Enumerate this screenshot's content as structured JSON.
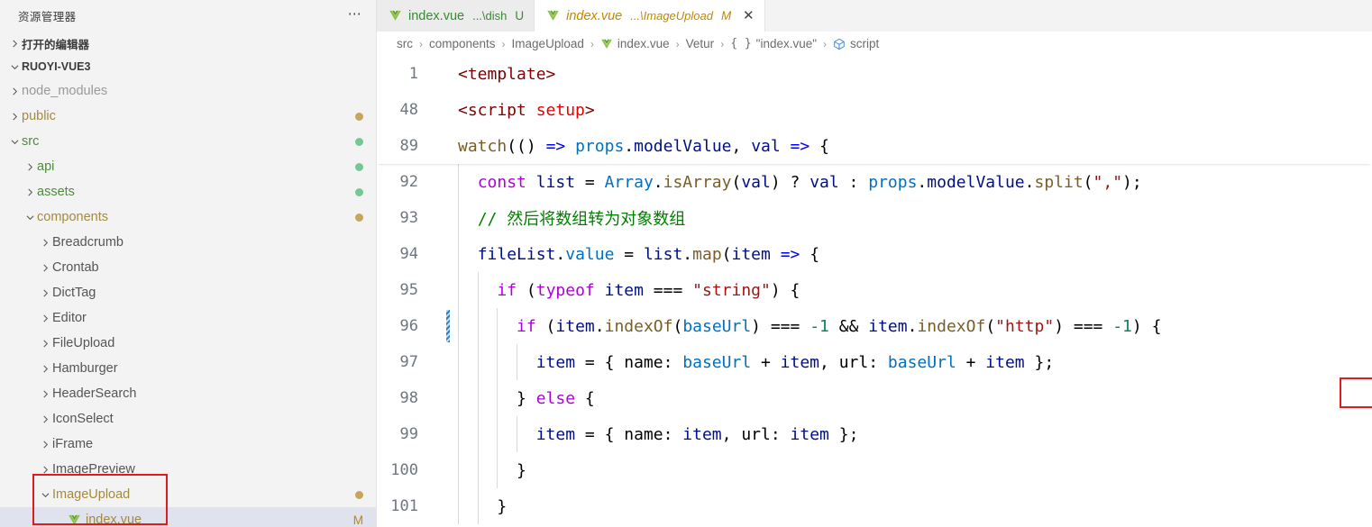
{
  "sidebar": {
    "title": "资源管理器",
    "more_label": "⋯",
    "open_editors_label": "打开的编辑器",
    "project_label": "RUOYI-VUE3",
    "tree": [
      {
        "label": "node_modules",
        "indent": 1,
        "arrow": "right",
        "color": "#9a9a9a",
        "status": ""
      },
      {
        "label": "public",
        "indent": 1,
        "arrow": "right",
        "color": "#a38a42",
        "status": "dot-mod"
      },
      {
        "label": "src",
        "indent": 1,
        "arrow": "down",
        "color": "#4f8a3f",
        "status": "dot-new"
      },
      {
        "label": "api",
        "indent": 2,
        "arrow": "right",
        "color": "#4f8a3f",
        "status": "dot-new"
      },
      {
        "label": "assets",
        "indent": 2,
        "arrow": "right",
        "color": "#4f8a3f",
        "status": "dot-new"
      },
      {
        "label": "components",
        "indent": 2,
        "arrow": "down",
        "color": "#a38a42",
        "status": "dot-mod"
      },
      {
        "label": "Breadcrumb",
        "indent": 3,
        "arrow": "right",
        "color": "#555555",
        "status": ""
      },
      {
        "label": "Crontab",
        "indent": 3,
        "arrow": "right",
        "color": "#555555",
        "status": ""
      },
      {
        "label": "DictTag",
        "indent": 3,
        "arrow": "right",
        "color": "#555555",
        "status": ""
      },
      {
        "label": "Editor",
        "indent": 3,
        "arrow": "right",
        "color": "#555555",
        "status": ""
      },
      {
        "label": "FileUpload",
        "indent": 3,
        "arrow": "right",
        "color": "#555555",
        "status": ""
      },
      {
        "label": "Hamburger",
        "indent": 3,
        "arrow": "right",
        "color": "#555555",
        "status": ""
      },
      {
        "label": "HeaderSearch",
        "indent": 3,
        "arrow": "right",
        "color": "#555555",
        "status": ""
      },
      {
        "label": "IconSelect",
        "indent": 3,
        "arrow": "right",
        "color": "#555555",
        "status": ""
      },
      {
        "label": "iFrame",
        "indent": 3,
        "arrow": "right",
        "color": "#555555",
        "status": ""
      },
      {
        "label": "ImagePreview",
        "indent": 3,
        "arrow": "right",
        "color": "#555555",
        "status": ""
      },
      {
        "label": "ImageUpload",
        "indent": 3,
        "arrow": "down",
        "color": "#a38a42",
        "status": "dot-mod"
      },
      {
        "label": "index.vue",
        "indent": 4,
        "arrow": "none",
        "color": "#a38a42",
        "status": "M",
        "icon": "vue",
        "selected": true
      }
    ],
    "colors": {
      "dot_modified": "#c8a45c",
      "dot_new": "#73c991",
      "badge_modified": "#bf8803",
      "annotation": "#e01b1b"
    }
  },
  "tabs": [
    {
      "name": "index.vue",
      "desc": "...\\dish",
      "badge": "U",
      "active": false,
      "color": "#388a34",
      "close": ""
    },
    {
      "name": "index.vue",
      "desc": "...\\ImageUpload",
      "badge": "M",
      "active": true,
      "color": "#bf8803",
      "close": "✕"
    }
  ],
  "breadcrumb": [
    {
      "label": "src",
      "icon": ""
    },
    {
      "label": "components",
      "icon": ""
    },
    {
      "label": "ImageUpload",
      "icon": ""
    },
    {
      "label": "index.vue",
      "icon": "vue-icon"
    },
    {
      "label": "Vetur",
      "icon": ""
    },
    {
      "label": "\"index.vue\"",
      "icon": "braces-icon"
    },
    {
      "label": "script",
      "icon": "cube-icon"
    }
  ],
  "breadcrumb_separator": "›",
  "sticky_lines": [
    {
      "num": "1",
      "tokens": [
        {
          "t": "<template>",
          "c": "t-tag"
        }
      ]
    },
    {
      "num": "48",
      "tokens": [
        {
          "t": "<script ",
          "c": "t-tag"
        },
        {
          "t": "setup",
          "c": "t-tagn"
        },
        {
          "t": ">",
          "c": "t-tag"
        }
      ]
    },
    {
      "num": "89",
      "tokens": [
        {
          "t": "watch",
          "c": "t-fn"
        },
        {
          "t": "((",
          "c": "t-punct"
        },
        {
          "t": ") ",
          "c": "t-punct"
        },
        {
          "t": "=>",
          "c": "t-arrow"
        },
        {
          "t": " ",
          "c": "t-plain"
        },
        {
          "t": "props",
          "c": "t-prop"
        },
        {
          "t": ".",
          "c": "t-punct"
        },
        {
          "t": "modelValue",
          "c": "t-var"
        },
        {
          "t": ", ",
          "c": "t-punct"
        },
        {
          "t": "val ",
          "c": "t-var"
        },
        {
          "t": "=>",
          "c": "t-arrow"
        },
        {
          "t": " {",
          "c": "t-punct"
        }
      ]
    }
  ],
  "code_lines": [
    {
      "num": "92",
      "indent": 2,
      "modified": false,
      "tokens": [
        {
          "t": "const",
          "c": "t-kw"
        },
        {
          "t": " ",
          "c": "t-plain"
        },
        {
          "t": "list",
          "c": "t-var"
        },
        {
          "t": " = ",
          "c": "t-punct"
        },
        {
          "t": "Array",
          "c": "t-prop"
        },
        {
          "t": ".",
          "c": "t-punct"
        },
        {
          "t": "isArray",
          "c": "t-fn"
        },
        {
          "t": "(",
          "c": "t-punct"
        },
        {
          "t": "val",
          "c": "t-var"
        },
        {
          "t": ") ? ",
          "c": "t-punct"
        },
        {
          "t": "val",
          "c": "t-var"
        },
        {
          "t": " : ",
          "c": "t-punct"
        },
        {
          "t": "props",
          "c": "t-prop"
        },
        {
          "t": ".",
          "c": "t-punct"
        },
        {
          "t": "modelValue",
          "c": "t-var"
        },
        {
          "t": ".",
          "c": "t-punct"
        },
        {
          "t": "split",
          "c": "t-fn"
        },
        {
          "t": "(",
          "c": "t-punct"
        },
        {
          "t": "\",\"",
          "c": "t-str"
        },
        {
          "t": ");",
          "c": "t-punct"
        }
      ]
    },
    {
      "num": "93",
      "indent": 2,
      "modified": false,
      "tokens": [
        {
          "t": "// 然后将数组转为对象数组",
          "c": "t-cmt"
        }
      ]
    },
    {
      "num": "94",
      "indent": 2,
      "modified": false,
      "tokens": [
        {
          "t": "fileList",
          "c": "t-var"
        },
        {
          "t": ".",
          "c": "t-punct"
        },
        {
          "t": "value",
          "c": "t-prop"
        },
        {
          "t": " = ",
          "c": "t-punct"
        },
        {
          "t": "list",
          "c": "t-var"
        },
        {
          "t": ".",
          "c": "t-punct"
        },
        {
          "t": "map",
          "c": "t-fn"
        },
        {
          "t": "(",
          "c": "t-punct"
        },
        {
          "t": "item ",
          "c": "t-var"
        },
        {
          "t": "=>",
          "c": "t-arrow"
        },
        {
          "t": " {",
          "c": "t-punct"
        }
      ]
    },
    {
      "num": "95",
      "indent": 3,
      "modified": false,
      "tokens": [
        {
          "t": "if",
          "c": "t-kw"
        },
        {
          "t": " (",
          "c": "t-punct"
        },
        {
          "t": "typeof",
          "c": "t-kw"
        },
        {
          "t": " ",
          "c": "t-plain"
        },
        {
          "t": "item",
          "c": "t-var"
        },
        {
          "t": " === ",
          "c": "t-punct"
        },
        {
          "t": "\"string\"",
          "c": "t-str"
        },
        {
          "t": ") {",
          "c": "t-punct"
        }
      ]
    },
    {
      "num": "96",
      "indent": 4,
      "modified": true,
      "tokens": [
        {
          "t": "if",
          "c": "t-kw"
        },
        {
          "t": " (",
          "c": "t-punct"
        },
        {
          "t": "item",
          "c": "t-var"
        },
        {
          "t": ".",
          "c": "t-punct"
        },
        {
          "t": "indexOf",
          "c": "t-fn"
        },
        {
          "t": "(",
          "c": "t-punct"
        },
        {
          "t": "baseUrl",
          "c": "t-prop"
        },
        {
          "t": ") === ",
          "c": "t-punct"
        },
        {
          "t": "-1",
          "c": "t-num"
        },
        {
          "t": " && ",
          "c": "t-punct"
        },
        {
          "t": "item",
          "c": "t-var"
        },
        {
          "t": ".",
          "c": "t-punct"
        },
        {
          "t": "indexOf",
          "c": "t-fn"
        },
        {
          "t": "(",
          "c": "t-punct"
        },
        {
          "t": "\"http\"",
          "c": "t-str"
        },
        {
          "t": ") === ",
          "c": "t-punct"
        },
        {
          "t": "-1",
          "c": "t-num"
        },
        {
          "t": ") {",
          "c": "t-punct"
        }
      ]
    },
    {
      "num": "97",
      "indent": 5,
      "modified": false,
      "tokens": [
        {
          "t": "item",
          "c": "t-var"
        },
        {
          "t": " = { ",
          "c": "t-punct"
        },
        {
          "t": "name",
          "c": "t-plain"
        },
        {
          "t": ": ",
          "c": "t-punct"
        },
        {
          "t": "baseUrl",
          "c": "t-prop"
        },
        {
          "t": " + ",
          "c": "t-punct"
        },
        {
          "t": "item",
          "c": "t-var"
        },
        {
          "t": ", ",
          "c": "t-punct"
        },
        {
          "t": "url",
          "c": "t-plain"
        },
        {
          "t": ": ",
          "c": "t-punct"
        },
        {
          "t": "baseUrl",
          "c": "t-prop"
        },
        {
          "t": " + ",
          "c": "t-punct"
        },
        {
          "t": "item",
          "c": "t-var"
        },
        {
          "t": " };",
          "c": "t-punct"
        }
      ]
    },
    {
      "num": "98",
      "indent": 4,
      "modified": false,
      "tokens": [
        {
          "t": "} ",
          "c": "t-punct"
        },
        {
          "t": "else",
          "c": "t-kw"
        },
        {
          "t": " {",
          "c": "t-punct"
        }
      ]
    },
    {
      "num": "99",
      "indent": 5,
      "modified": false,
      "tokens": [
        {
          "t": "item",
          "c": "t-var"
        },
        {
          "t": " = { ",
          "c": "t-punct"
        },
        {
          "t": "name",
          "c": "t-plain"
        },
        {
          "t": ": ",
          "c": "t-punct"
        },
        {
          "t": "item",
          "c": "t-var"
        },
        {
          "t": ", ",
          "c": "t-punct"
        },
        {
          "t": "url",
          "c": "t-plain"
        },
        {
          "t": ": ",
          "c": "t-punct"
        },
        {
          "t": "item",
          "c": "t-var"
        },
        {
          "t": " };",
          "c": "t-punct"
        }
      ]
    },
    {
      "num": "100",
      "indent": 4,
      "modified": false,
      "tokens": [
        {
          "t": "}",
          "c": "t-punct"
        }
      ]
    },
    {
      "num": "101",
      "indent": 3,
      "modified": false,
      "tokens": [
        {
          "t": "}",
          "c": "t-punct"
        }
      ]
    }
  ],
  "annotations": {
    "code_highlight_text": "&& item.indexOf(\"http\") === -1",
    "sidebar_highlight_labels": [
      "ImageUpload",
      "index.vue"
    ]
  }
}
